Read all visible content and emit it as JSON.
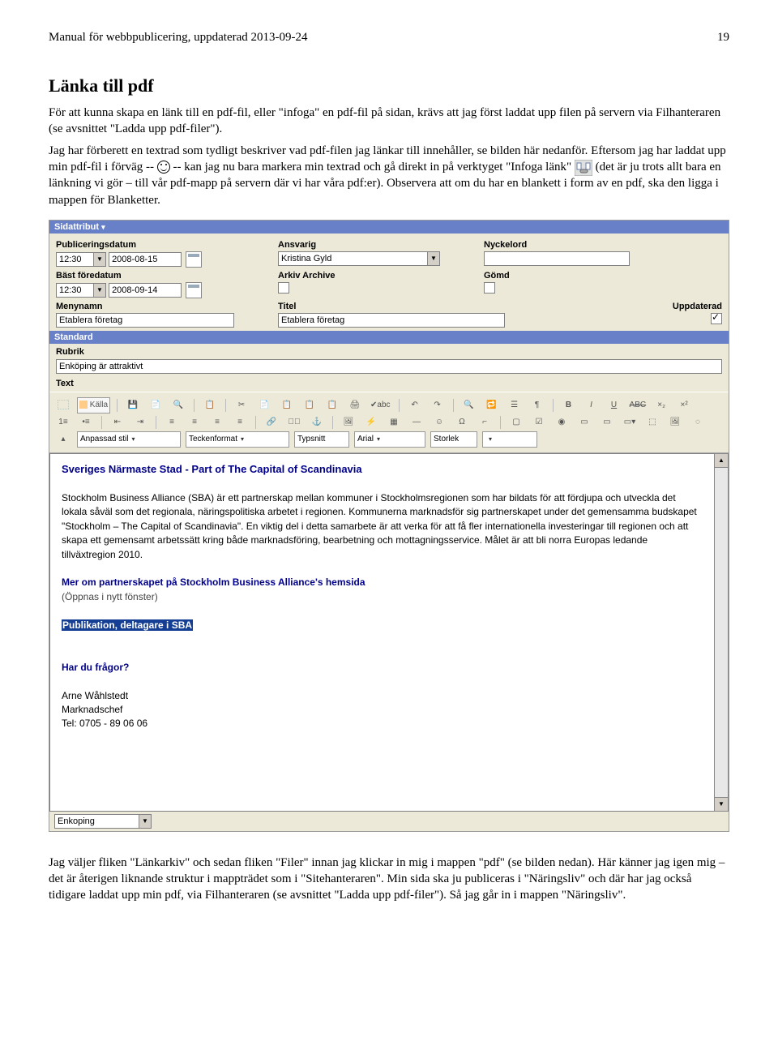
{
  "header": {
    "title": "Manual för webbpublicering, uppdaterad 2013-09-24",
    "page": "19"
  },
  "h1": "Länka till pdf",
  "para1": "För att kunna skapa en länk till en pdf-fil, eller \"infoga\" en pdf-fil på sidan, krävs att jag först laddat upp filen på servern via Filhanteraren (se avsnittet \"Ladda upp pdf-filer\").",
  "para2": "Jag har förberett en textrad som tydligt beskriver vad pdf-filen jag länkar till innehåller, se bilden här nedanför. Eftersom jag har laddat upp min pdf-fil i förväg -- ",
  "para2b": " -- kan jag nu bara markera min textrad och gå direkt in på verktyget \"Infoga länk\" ",
  "para2c": " (det är ju trots allt bara en länkning vi gör – till vår pdf-mapp på servern där vi har våra pdf:er). Observera att om du har en blankett i form av en pdf, ska den ligga i mappen för Blanketter.",
  "app": {
    "bar1": "Sidattribut",
    "labels": {
      "pubDate": "Publiceringsdatum",
      "ansvarig": "Ansvarig",
      "nyckelord": "Nyckelord",
      "bast": "Bäst föredatum",
      "arkiv": "Arkiv Archive",
      "gomd": "Gömd",
      "menynamn": "Menynamn",
      "titel": "Titel",
      "uppdaterad": "Uppdaterad",
      "rubrik": "Rubrik",
      "text": "Text"
    },
    "values": {
      "time1": "12:30",
      "date1": "2008-08-15",
      "time2": "12:30",
      "date2": "2008-09-14",
      "ansvarig": "Kristina Gyld",
      "menynamn": "Etablera företag",
      "titel": "Etablera företag",
      "rubrik": "Enköping är attraktivt",
      "bottom": "Enkoping"
    },
    "bar2": "Standard",
    "toolbar": {
      "kalla": "Källa",
      "stil": "Anpassad stil",
      "format": "Teckenformat",
      "typsnittLbl": "Typsnitt",
      "typsnitt": "Arial",
      "storlek": "Storlek"
    },
    "content": {
      "h1": "Sveriges Närmaste Stad - Part of The Capital of Scandinavia",
      "body": "Stockholm Business Alliance (SBA) är ett partnerskap mellan kommuner i Stockholmsregionen som har bildats för att fördjupa och utveckla det lokala såväl som det regionala, näringspolitiska arbetet i regionen. Kommunerna marknadsför sig partnerskapet under det gemensamma budskapet \"Stockholm – The Capital of Scandinavia\". En viktig del i detta samarbete är att verka för att få fler internationella investeringar till regionen och att skapa ett gemensamt arbetssätt kring både marknadsföring, bearbetning och mottagningsservice. Målet är att bli norra Europas ledande tillväxtregion 2010.",
      "link": "Mer om partnerskapet på Stockholm Business Alliance's hemsida",
      "linkNote": "(Öppnas i nytt fönster)",
      "highlight": "Publikation, deltagare i SBA",
      "q": "Har du frågor?",
      "name": "Arne Wåhlstedt",
      "role": "Marknadschef",
      "tel": "Tel: 0705 - 89 06 06"
    }
  },
  "afterText": "Jag väljer fliken \"Länkarkiv\" och sedan fliken \"Filer\" innan jag klickar in mig i mappen \"pdf\" (se bilden nedan). Här känner jag igen mig – det är återigen liknande struktur i mappträdet som i \"Sitehanteraren\". Min sida ska ju publiceras i \"Näringsliv\" och där har jag också tidigare laddat upp min pdf, via Filhanteraren (se avsnittet \"Ladda upp pdf-filer\"). Så jag går in i mappen \"Näringsliv\"."
}
